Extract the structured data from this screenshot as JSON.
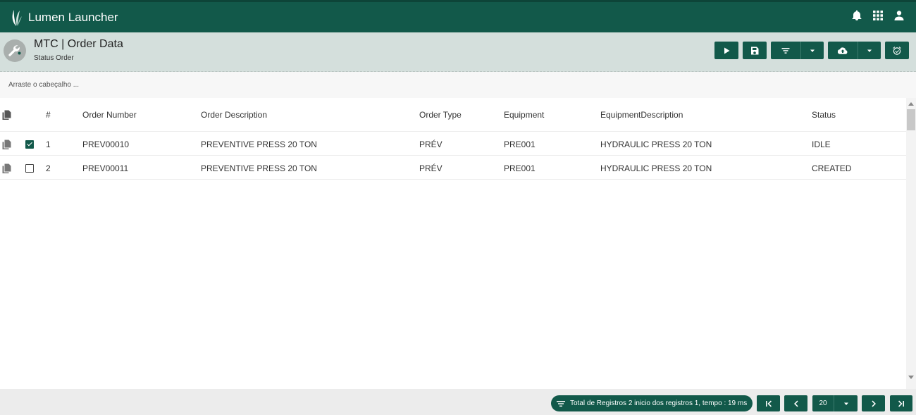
{
  "app": {
    "title": "Lumen Launcher",
    "brand_color": "#12594a",
    "icons": [
      "leaf-logo-icon",
      "bell-icon",
      "apps-grid-icon",
      "user-icon"
    ]
  },
  "page": {
    "title": "MTC | Order Data",
    "subtitle": "Status Order",
    "toolbar_icons": [
      "play-icon",
      "save-icon",
      "filter-icon",
      "chevron-down-icon",
      "cloud-upload-icon",
      "chevron-down-icon",
      "alarm-icon"
    ]
  },
  "groupbar": {
    "placeholder": "Arraste o cabeçalho ..."
  },
  "grid": {
    "columns": {
      "num": "#",
      "order_number": "Order Number",
      "order_description": "Order Description",
      "order_type": "Order Type",
      "equipment": "Equipment",
      "equipment_description": "EquipmentDescription",
      "status": "Status"
    },
    "rows": [
      {
        "checked": true,
        "num": "1",
        "order_number": "PREV00010",
        "order_description": "PREVENTIVE PRESS 20 TON",
        "order_type": "PRÉV",
        "equipment": "PRE001",
        "equipment_description": "HYDRAULIC PRESS 20 TON",
        "status": "IDLE"
      },
      {
        "checked": false,
        "num": "2",
        "order_number": "PREV00011",
        "order_description": "PREVENTIVE PRESS 20 TON",
        "order_type": "PRÉV",
        "equipment": "PRE001",
        "equipment_description": "HYDRAULIC PRESS 20 TON",
        "status": "CREATED"
      }
    ]
  },
  "footer": {
    "summary": "Total de Registros 2 inicio dos registros 1, tempo : 19 ms",
    "page_size": "20"
  }
}
